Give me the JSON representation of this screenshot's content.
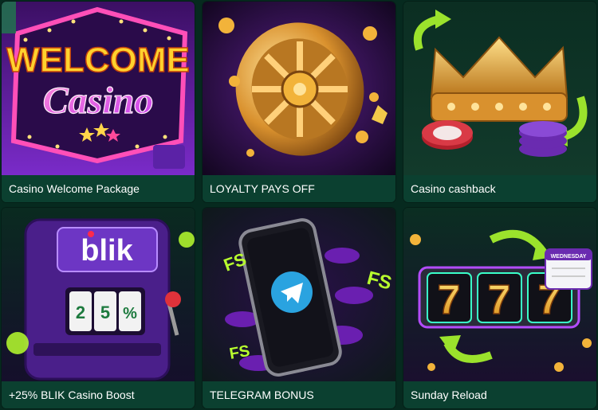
{
  "promotions": [
    {
      "title": "Casino Welcome Package",
      "art_text": [
        "WELCOME",
        "Casino"
      ]
    },
    {
      "title": "LOYALTY PAYS OFF"
    },
    {
      "title": "Casino cashback"
    },
    {
      "title": "+25% BLIK Casino Boost",
      "art_text": [
        "blik",
        "2",
        "5",
        "%"
      ]
    },
    {
      "title": "TELEGRAM BONUS",
      "art_text": [
        "FS",
        "FS",
        "FS"
      ]
    },
    {
      "title": "Sunday Reload",
      "art_text": [
        "7",
        "7",
        "7",
        "WEDNESDAY"
      ]
    }
  ],
  "colors": {
    "page_bg": "#062a1f",
    "label_bg": "#0b4030",
    "label_text": "#ffffff",
    "accent_purple": "#6a1fb0",
    "accent_lime": "#b8ff2e",
    "accent_gold": "#f2b33a",
    "accent_pink": "#ff3fa8"
  },
  "icons": [
    "neon-sign-icon",
    "vault-wheel-icon",
    "crown-icon",
    "slot-machine-icon",
    "telegram-icon",
    "reels-777-icon",
    "calendar-icon"
  ]
}
